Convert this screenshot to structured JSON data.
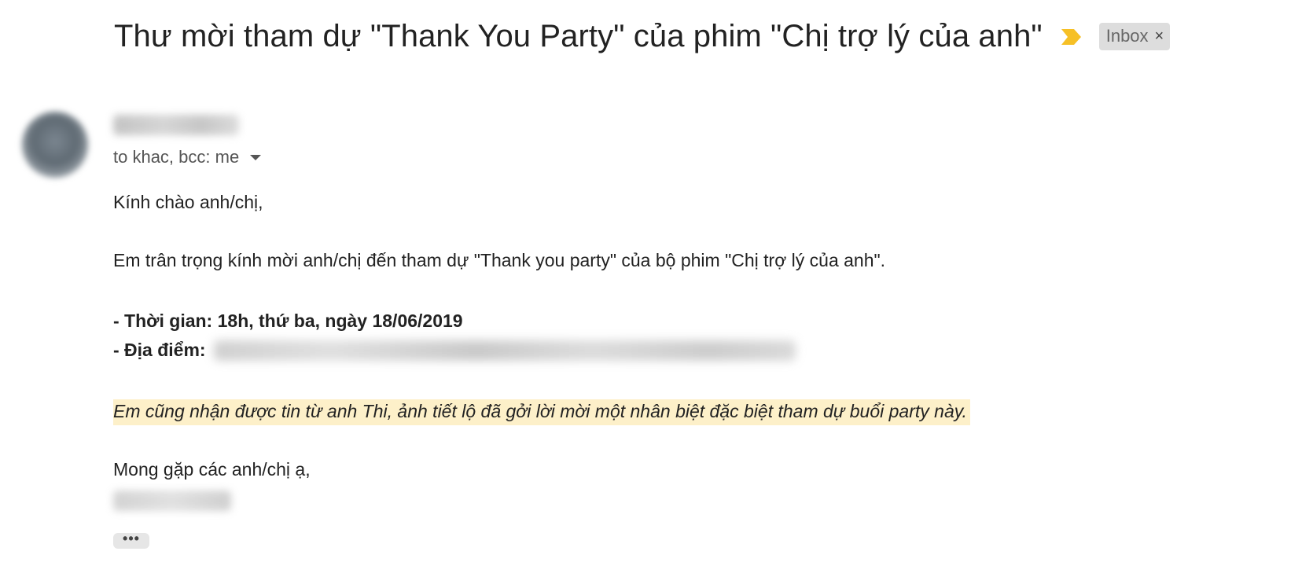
{
  "email": {
    "subject": "Thư mời tham dự \"Thank You Party\" của phim \"Chị trợ lý của anh\"",
    "label": "Inbox",
    "label_remove": "×",
    "importance_color": "#f6c026",
    "recipients": "to khac, bcc: me",
    "body": {
      "greeting": "Kính chào anh/chị,",
      "invite": "Em trân trọng kính mời anh/chị đến tham dự \"Thank you party\" của bộ phim \"Chị trợ lý của anh\".",
      "time": "- Thời gian: 18h, thứ ba, ngày 18/06/2019",
      "place_label": "- Địa điểm:",
      "highlight": "Em cũng nhận được tin từ anh Thi, ảnh tiết lộ đã gởi lời mời một nhân biệt đặc biệt tham dự buổi party này.",
      "highlight_color": "#fdf0c9",
      "closing": "Mong gặp các anh/chị ạ,"
    },
    "trimmed_content_label": "•••"
  }
}
